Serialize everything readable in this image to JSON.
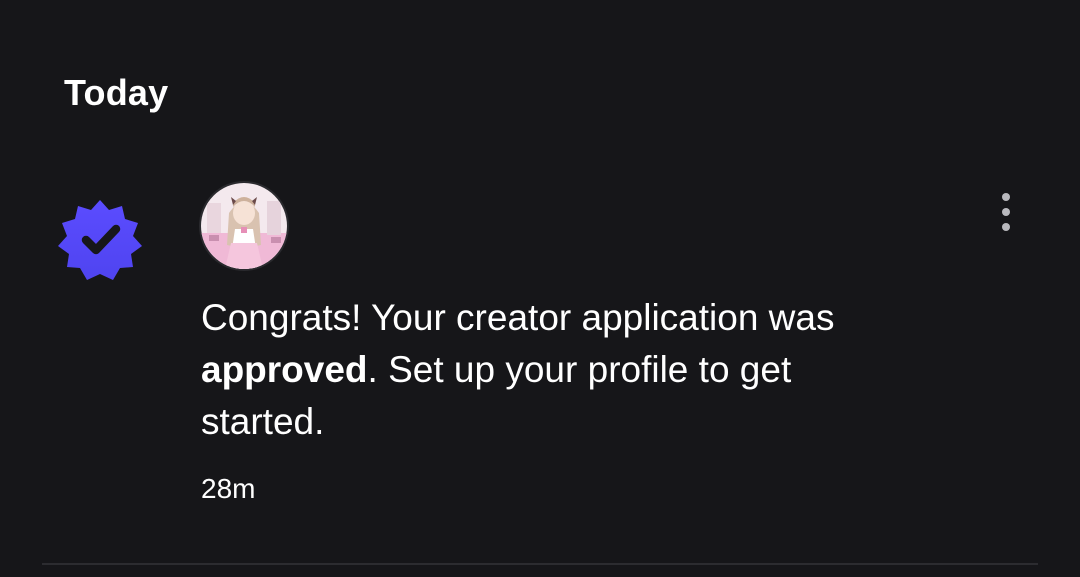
{
  "section": {
    "title": "Today"
  },
  "notification": {
    "type_icon": "verified-badge-icon",
    "avatar_icon": "creator-avatar",
    "menu_icon": "more-vertical-icon",
    "message": {
      "part1": "Congrats! Your creator application was ",
      "bold": "approved",
      "part2": ". Set up your profile to get started."
    },
    "timestamp": "28m"
  },
  "colors": {
    "background": "#161619",
    "badge": "#5a4bff",
    "text": "#ffffff",
    "divider": "#2c2c30"
  }
}
